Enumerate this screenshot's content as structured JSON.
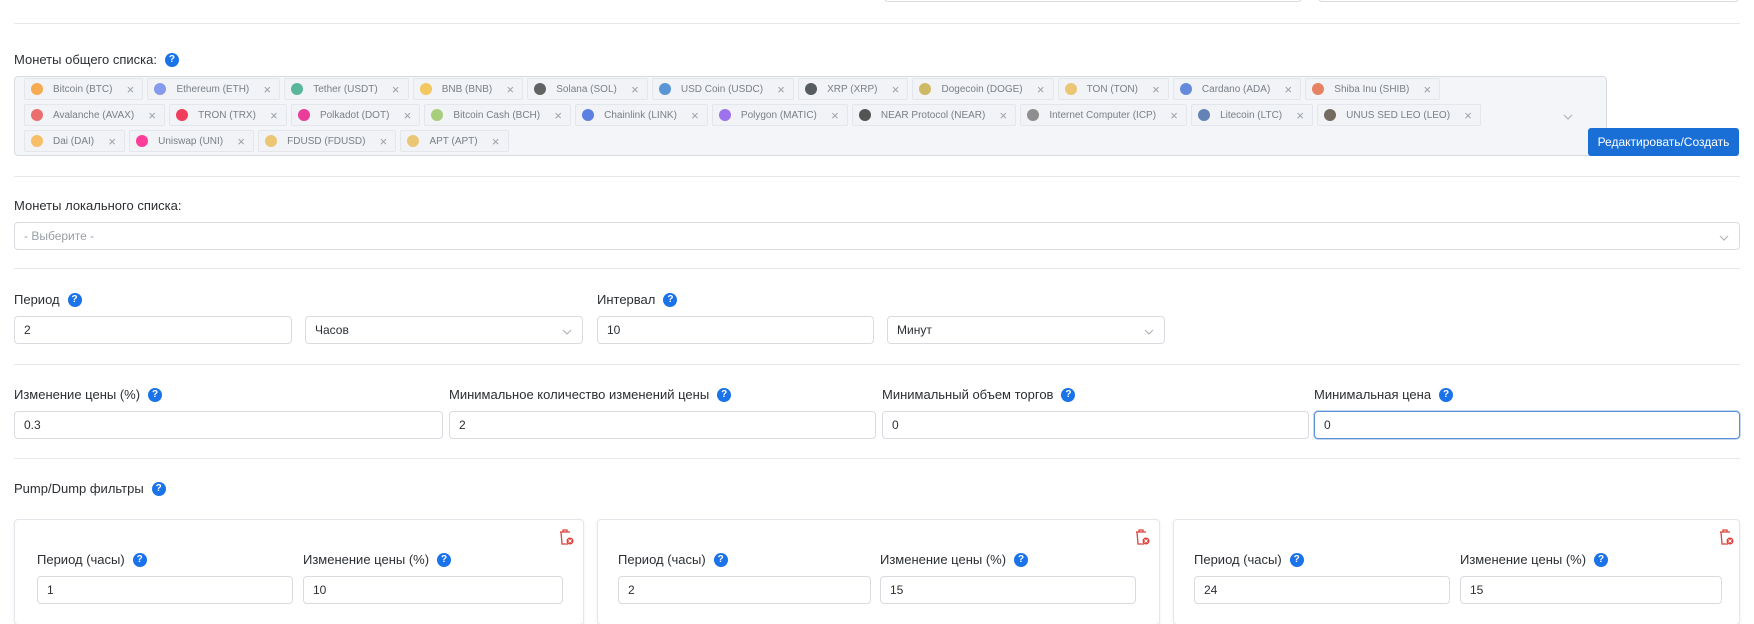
{
  "common_coins": {
    "label": "Монеты общего списка:",
    "help": "?",
    "rows": [
      [
        {
          "name": "Bitcoin (BTC)",
          "color": "#f7931a",
          "remove": "×"
        },
        {
          "name": "Ethereum (ETH)",
          "color": "#627eea",
          "remove": "×"
        },
        {
          "name": "Tether (USDT)",
          "color": "#26a17b",
          "remove": "×"
        },
        {
          "name": "BNB (BNB)",
          "color": "#f3ba2f",
          "remove": "×"
        },
        {
          "name": "Solana (SOL)",
          "color": "#333333",
          "remove": "×"
        },
        {
          "name": "USD Coin (USDC)",
          "color": "#2775ca",
          "remove": "×"
        },
        {
          "name": "XRP (XRP)",
          "color": "#23292f",
          "remove": "×"
        },
        {
          "name": "Dogecoin (DOGE)",
          "color": "#c2a633",
          "remove": "×"
        },
        {
          "name": "TON (TON)",
          "color": "#e8b84a",
          "remove": "×"
        },
        {
          "name": "Cardano (ADA)",
          "color": "#3468d1",
          "remove": "×"
        },
        {
          "name": "Shiba Inu (SHIB)",
          "color": "#e15b2f",
          "remove": "×"
        }
      ],
      [
        {
          "name": "Avalanche (AVAX)",
          "color": "#e84142",
          "remove": "×"
        },
        {
          "name": "TRON (TRX)",
          "color": "#ef0027",
          "remove": "×"
        },
        {
          "name": "Polkadot (DOT)",
          "color": "#e6007a",
          "remove": "×"
        },
        {
          "name": "Bitcoin Cash (BCH)",
          "color": "#8dc351",
          "remove": "×"
        },
        {
          "name": "Chainlink (LINK)",
          "color": "#2a5ada",
          "remove": "×"
        },
        {
          "name": "Polygon (MATIC)",
          "color": "#8247e5",
          "remove": "×"
        },
        {
          "name": "NEAR Protocol (NEAR)",
          "color": "#1f1f1f",
          "remove": "×"
        },
        {
          "name": "Internet Computer (ICP)",
          "color": "#6c6c6c",
          "remove": "×"
        },
        {
          "name": "Litecoin (LTC)",
          "color": "#345d9d",
          "remove": "×"
        },
        {
          "name": "UNUS SED LEO (LEO)",
          "color": "#4a3c2e",
          "remove": "×"
        }
      ],
      [
        {
          "name": "Dai (DAI)",
          "color": "#f5ac37",
          "remove": "×"
        },
        {
          "name": "Uniswap (UNI)",
          "color": "#ff007a",
          "remove": "×"
        },
        {
          "name": "FDUSD (FDUSD)",
          "color": "#e8b84a",
          "remove": "×"
        },
        {
          "name": "APT (APT)",
          "color": "#e8b84a",
          "remove": "×"
        }
      ]
    ],
    "edit_button": "Редактировать/Создать"
  },
  "local_coins": {
    "label": "Монеты локального списка:",
    "placeholder": "- Выберите -"
  },
  "period": {
    "label": "Период",
    "value": "2",
    "unit": "Часов"
  },
  "interval": {
    "label": "Интервал",
    "value": "10",
    "unit": "Минут"
  },
  "filters": {
    "price_change": {
      "label": "Изменение цены (%)",
      "value": "0.3"
    },
    "min_changes": {
      "label": "Минимальное количество изменений цены",
      "value": "2"
    },
    "min_volume": {
      "label": "Минимальный объем торгов",
      "value": "0"
    },
    "min_price": {
      "label": "Минимальная цена",
      "value": "0"
    }
  },
  "pump_dump": {
    "label": "Pump/Dump фильтры",
    "cards": [
      {
        "period_label": "Период (часы)",
        "period_value": "1",
        "change_label": "Изменение цены (%)",
        "change_value": "10"
      },
      {
        "period_label": "Период (часы)",
        "period_value": "2",
        "change_label": "Изменение цены (%)",
        "change_value": "15"
      },
      {
        "period_label": "Период (часы)",
        "period_value": "24",
        "change_label": "Изменение цены (%)",
        "change_value": "15"
      }
    ]
  },
  "colors": {
    "primary": "#1a6fd6",
    "help": "#1a73e8",
    "danger": "#e0413a",
    "border": "#d8dbe0"
  }
}
